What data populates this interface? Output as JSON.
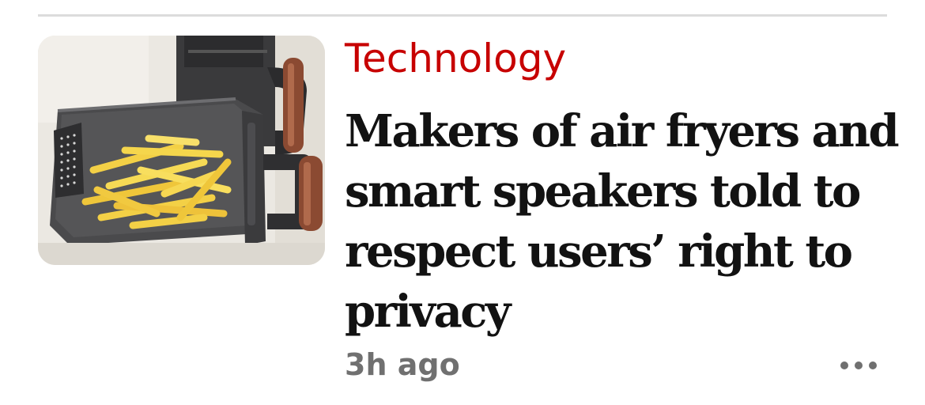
{
  "article": {
    "kicker": "Technology",
    "headline": "Makers of air fryers and smart speakers told to respect users’ right to privacy",
    "timestamp": "3h ago",
    "image_alt": "Air fryer basket with chips",
    "more_icon": "more-horizontal-icon"
  },
  "colors": {
    "kicker": "#c70000",
    "headline": "#121212",
    "timestamp": "#707070",
    "rule": "#dcdcdc"
  }
}
